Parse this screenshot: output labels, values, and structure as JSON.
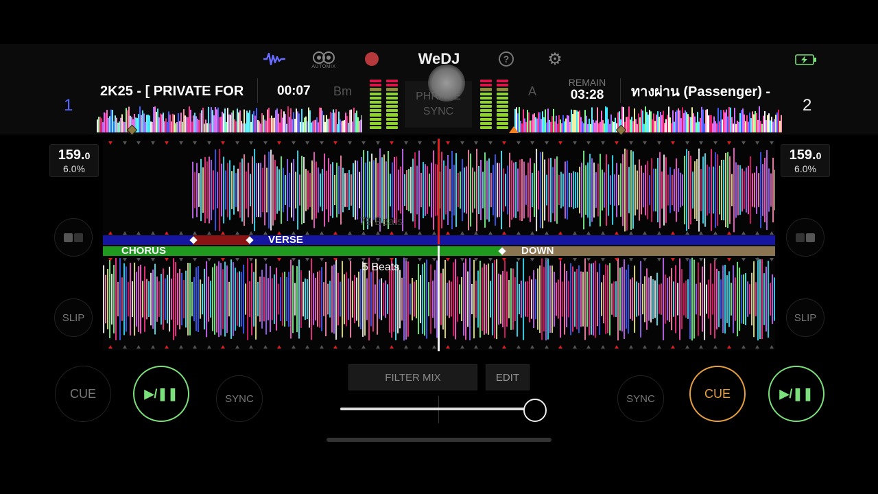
{
  "app": {
    "title": "WeDJ",
    "automix_label": "AUTOMIX"
  },
  "deck1": {
    "number": "1",
    "title": "2K25 - [ PRIVATE FOR",
    "elapsed": "00:07",
    "key": "Bm",
    "bpm_int": "159.",
    "bpm_dec": "0",
    "pitch": "6.0%",
    "cue_label": "CUE",
    "sync_label": "SYNC",
    "slip_label": "SLIP",
    "play_label": "▶/❚❚"
  },
  "deck2": {
    "number": "2",
    "title": "ทางผ่าน (Passenger) -",
    "remain_label": "REMAIN",
    "remain": "03:28",
    "key": "A",
    "bpm_int": "159.",
    "bpm_dec": "0",
    "pitch": "6.0%",
    "cue_label": "CUE",
    "sync_label": "SYNC",
    "slip_label": "SLIP",
    "play_label": "▶/❚❚"
  },
  "phrase_sync": {
    "line1": "PHRASE",
    "line2": "SYNC"
  },
  "waveform": {
    "deck1_phrase": "VERSE",
    "deck2_phrase_left": "CHORUS",
    "deck2_phrase_right": "DOWN",
    "beats_top": "79 Beats",
    "beats_bottom": "5 Beats"
  },
  "mixer": {
    "filter_label": "FILTER MIX",
    "edit_label": "EDIT",
    "crossfader_value": 1.0
  },
  "icons": {
    "waveform": "waveform-icon",
    "automix": "automix-icon",
    "record": "record-icon",
    "help": "help-icon",
    "settings": "gear-icon",
    "battery": "battery-charging-icon"
  },
  "colors": {
    "accent_blue": "#5566ff",
    "play_green": "#7be07b",
    "cue_orange": "#e8a040",
    "record_red": "#c0393b",
    "verse_blue": "#1515a0",
    "chorus_green": "#1f9a1f",
    "down_tan": "#8a7550",
    "playhead_red": "#e02020"
  }
}
